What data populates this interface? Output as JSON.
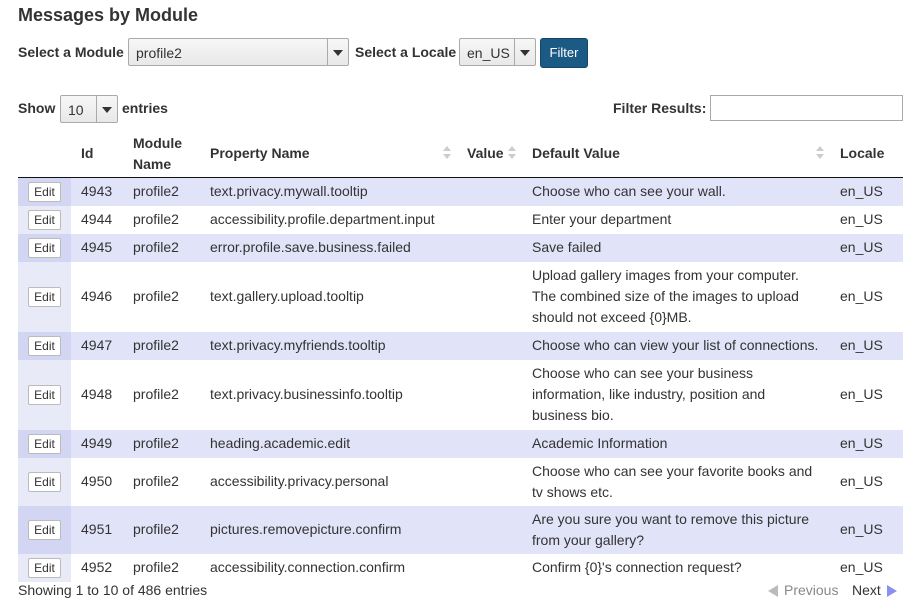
{
  "page": {
    "title": "Messages by Module"
  },
  "filters": {
    "module_label": "Select a Module",
    "module_value": "profile2",
    "locale_label": "Select a Locale",
    "locale_value": "en_US",
    "filter_button": "Filter"
  },
  "length": {
    "show_label": "Show",
    "value": "10",
    "entries_label": "entries"
  },
  "search": {
    "label": "Filter Results:",
    "value": ""
  },
  "table": {
    "headers": {
      "id": "Id",
      "module_line1": "Module",
      "module_line2": "Name",
      "property": "Property Name",
      "value": "Value",
      "default": "Default Value",
      "locale": "Locale"
    },
    "edit_label": "Edit",
    "rows": [
      {
        "id": "4943",
        "module": "profile2",
        "property": "text.privacy.mywall.tooltip",
        "value": "",
        "default": "Choose who can see your wall.",
        "locale": "en_US"
      },
      {
        "id": "4944",
        "module": "profile2",
        "property": "accessibility.profile.department.input",
        "value": "",
        "default": "Enter your department",
        "locale": "en_US"
      },
      {
        "id": "4945",
        "module": "profile2",
        "property": "error.profile.save.business.failed",
        "value": "",
        "default": "Save failed",
        "locale": "en_US"
      },
      {
        "id": "4946",
        "module": "profile2",
        "property": "text.gallery.upload.tooltip",
        "value": "",
        "default": "Upload gallery images from your computer. The combined size of the images to upload should not exceed {0}MB.",
        "locale": "en_US"
      },
      {
        "id": "4947",
        "module": "profile2",
        "property": "text.privacy.myfriends.tooltip",
        "value": "",
        "default": "Choose who can view your list of connections.",
        "locale": "en_US"
      },
      {
        "id": "4948",
        "module": "profile2",
        "property": "text.privacy.businessinfo.tooltip",
        "value": "",
        "default": "Choose who can see your business information, like industry, position and business bio.",
        "locale": "en_US"
      },
      {
        "id": "4949",
        "module": "profile2",
        "property": "heading.academic.edit",
        "value": "",
        "default": "Academic Information",
        "locale": "en_US"
      },
      {
        "id": "4950",
        "module": "profile2",
        "property": "accessibility.privacy.personal",
        "value": "",
        "default": "Choose who can see your favorite books and tv shows etc.",
        "locale": "en_US"
      },
      {
        "id": "4951",
        "module": "profile2",
        "property": "pictures.removepicture.confirm",
        "value": "",
        "default": "Are you sure you want to remove this picture from your gallery?",
        "locale": "en_US"
      },
      {
        "id": "4952",
        "module": "profile2",
        "property": "accessibility.connection.confirm",
        "value": "",
        "default": "Confirm {0}'s connection request?",
        "locale": "en_US"
      }
    ]
  },
  "footer": {
    "info": "Showing 1 to 10 of 486 entries",
    "previous": "Previous",
    "next": "Next"
  },
  "colors": {
    "accent": "#1c5a86",
    "row_odd": "#e1e3f8",
    "row_even": "#ffffff"
  }
}
